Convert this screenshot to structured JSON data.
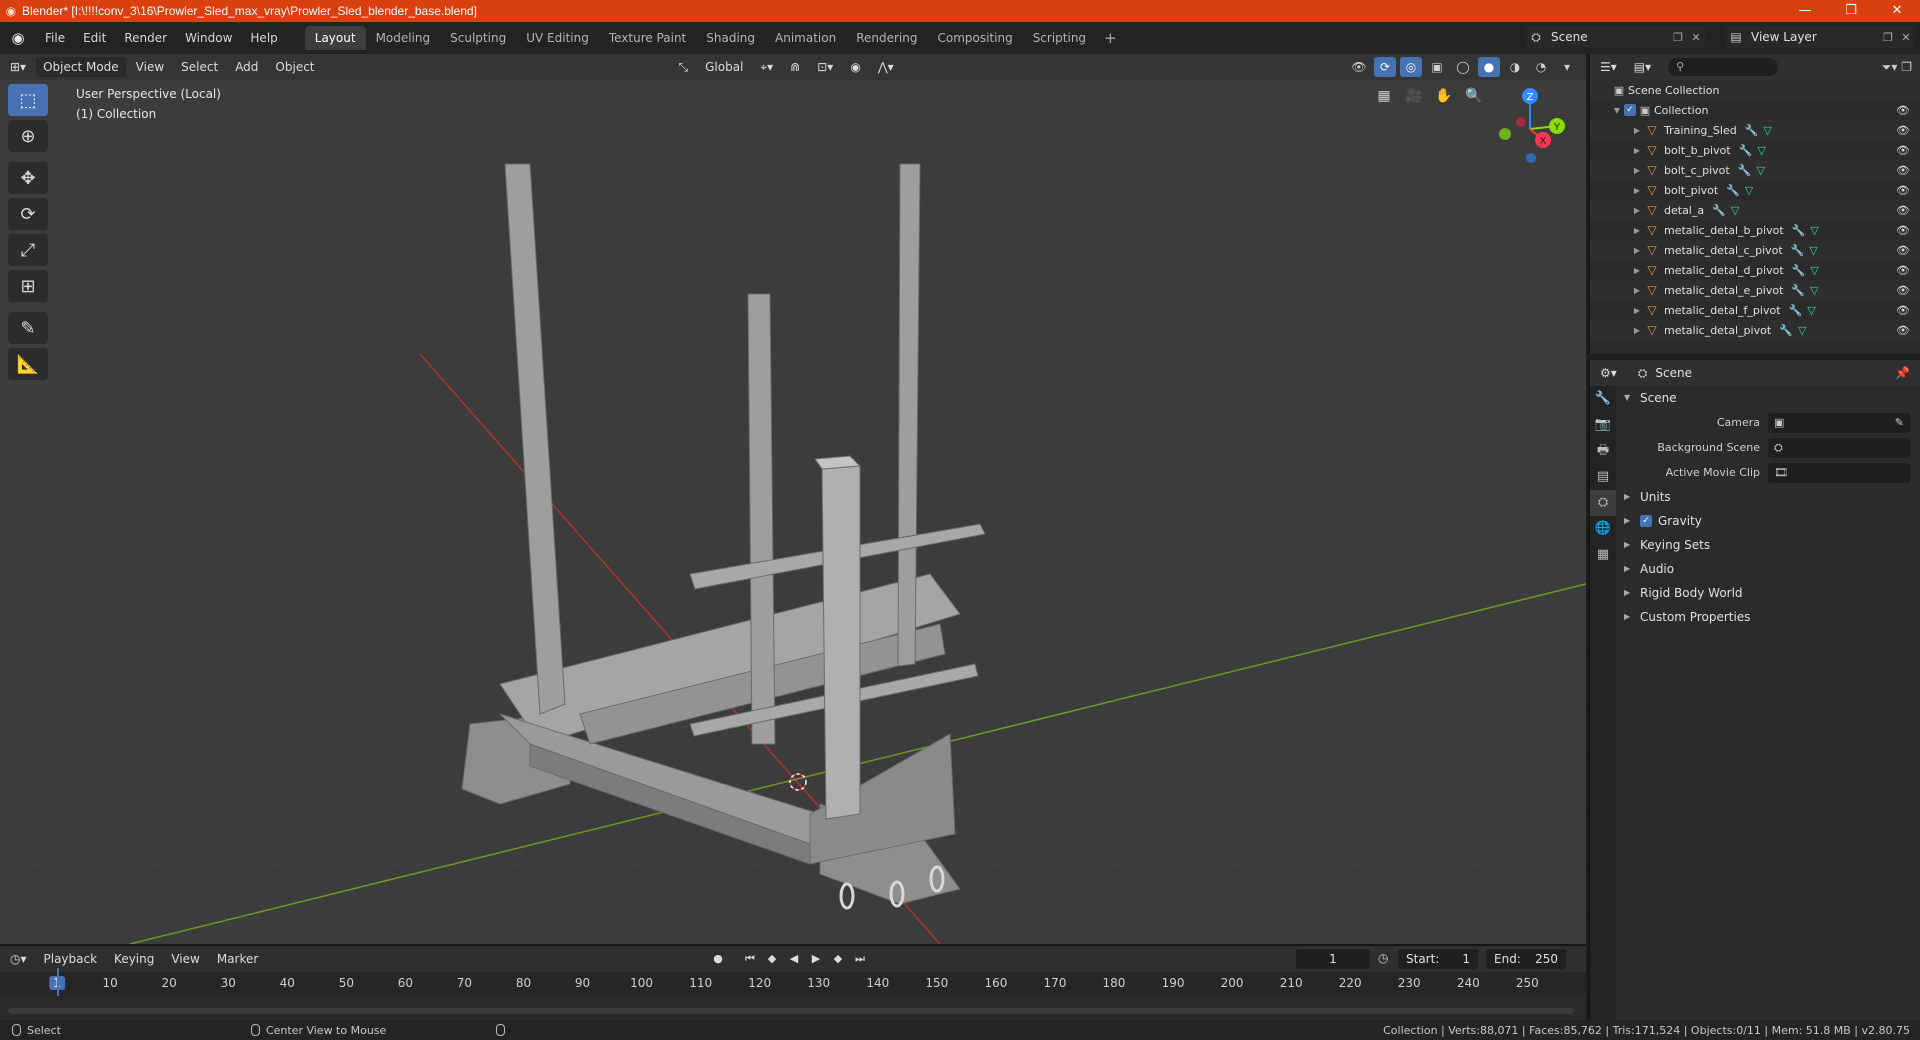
{
  "titlebar": {
    "title": "Blender* [I:\\!!!!conv_3\\16\\Prowler_Sled_max_vray\\Prowler_Sled_blender_base.blend]",
    "minimize": "—",
    "maximize": "❐",
    "close": "✕"
  },
  "menu": {
    "items": [
      "File",
      "Edit",
      "Render",
      "Window",
      "Help"
    ],
    "workspaces": [
      "Layout",
      "Modeling",
      "Sculpting",
      "UV Editing",
      "Texture Paint",
      "Shading",
      "Animation",
      "Rendering",
      "Compositing",
      "Scripting"
    ],
    "active_workspace": "Layout",
    "scene": "Scene",
    "view_layer": "View Layer"
  },
  "viewport": {
    "mode": "Object Mode",
    "menus": [
      "View",
      "Select",
      "Add",
      "Object"
    ],
    "orientation": "Global",
    "info_line1": "User Perspective (Local)",
    "info_line2": "(1) Collection",
    "gizmo": {
      "x": "X",
      "y": "Y",
      "z": "Z"
    }
  },
  "timeline": {
    "menus": [
      "Playback",
      "Keying",
      "View",
      "Marker"
    ],
    "current_frame": "1",
    "start_label": "Start:",
    "start": "1",
    "end_label": "End:",
    "end": "250",
    "ticks": [
      1,
      10,
      20,
      30,
      40,
      50,
      60,
      70,
      80,
      90,
      100,
      110,
      120,
      130,
      140,
      150,
      160,
      170,
      180,
      190,
      200,
      210,
      220,
      230,
      240,
      250
    ]
  },
  "statusbar": {
    "select": "Select",
    "center_view": "Center View to Mouse",
    "stats": "Collection | Verts:88,071 | Faces:85,762 | Tris:171,524 | Objects:0/11 | Mem: 51.8 MB | v2.80.75"
  },
  "outliner": {
    "scene_collection": "Scene Collection",
    "collection": "Collection",
    "objects": [
      "Training_Sled",
      "bolt_b_pivot",
      "bolt_c_pivot",
      "bolt_pivot",
      "detal_a",
      "metalic_detal_b_pivot",
      "metalic_detal_c_pivot",
      "metalic_detal_d_pivot",
      "metalic_detal_e_pivot",
      "metalic_detal_f_pivot",
      "metalic_detal_pivot"
    ]
  },
  "properties": {
    "context": "Scene",
    "panel": "Scene",
    "camera_label": "Camera",
    "background_scene_label": "Background Scene",
    "active_clip_label": "Active Movie Clip",
    "subpanels": [
      "Units",
      "Gravity",
      "Keying Sets",
      "Audio",
      "Rigid Body World",
      "Custom Properties"
    ],
    "gravity_enabled": true
  },
  "colors": {
    "accent": "#4772b3",
    "titlebar": "#d9400f",
    "x_axis": "#ff3352",
    "y_axis": "#8bdc00",
    "z_axis": "#2c8fff"
  }
}
